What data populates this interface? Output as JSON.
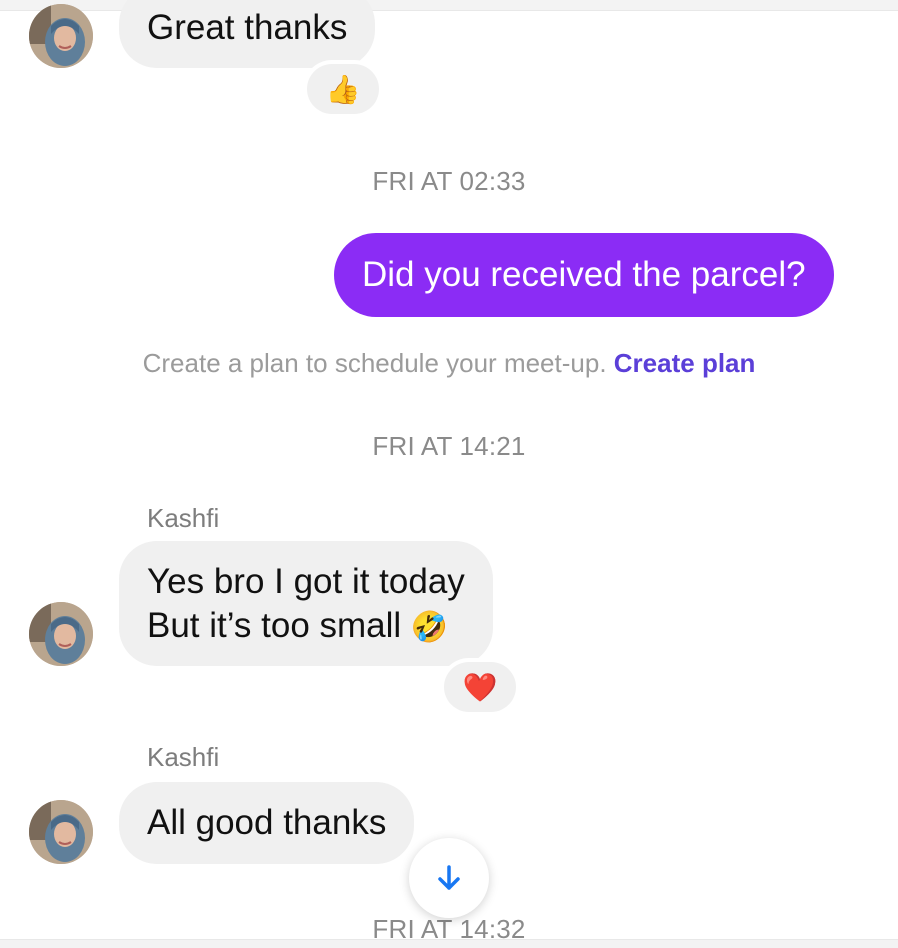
{
  "messages": {
    "m1": {
      "text": "Great thanks",
      "reaction": "👍"
    },
    "ts1": "FRI AT 02:33",
    "m2": {
      "text": "Did you received the parcel?"
    },
    "plan": {
      "text": "Create a plan to schedule your meet-up.",
      "link": "Create plan"
    },
    "ts2": "FRI AT 14:21",
    "m3": {
      "sender": "Kashfi",
      "line1": "Yes bro I got it today",
      "line2": "But it’s too small",
      "emoji": "🤣",
      "reaction": "❤️"
    },
    "m4": {
      "sender": "Kashfi",
      "text": "All good thanks"
    },
    "ts3": "FRI AT 14:32"
  },
  "colors": {
    "outgoing_bubble": "#8b2cf5",
    "incoming_bubble": "#f0f0f0",
    "link": "#5b3fd8",
    "scroll_arrow": "#1877f2"
  },
  "icons": {
    "scroll_button": "arrow-down-icon"
  }
}
